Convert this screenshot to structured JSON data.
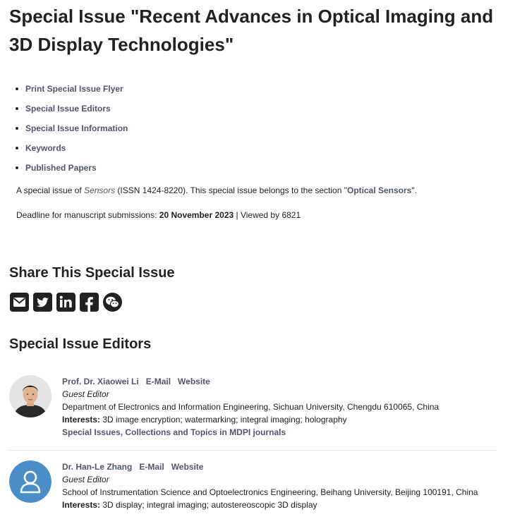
{
  "page": {
    "title": "Special Issue \"Recent Advances in Optical Imaging and 3D Display Technologies\""
  },
  "toc": [
    "Print Special Issue Flyer",
    "Special Issue Editors",
    "Special Issue Information",
    "Keywords",
    "Published Papers"
  ],
  "info": {
    "prefix": "A special issue of ",
    "journal": "Sensors",
    "issn_text": " (ISSN 1424-8220). This special issue belongs to the section \"",
    "section": "Optical Sensors",
    "suffix": "\".",
    "deadline_label": "Deadline for manuscript submissions: ",
    "deadline": "20 November 2023",
    "viewed_text": " | Viewed by 6821"
  },
  "share": {
    "heading": "Share This Special Issue",
    "icons": [
      "email-icon",
      "twitter-icon",
      "linkedin-icon",
      "facebook-icon",
      "wechat-icon"
    ]
  },
  "editors": {
    "heading": "Special Issue Editors",
    "list": [
      {
        "name": "Prof. Dr. Xiaowei Li",
        "email_label": "E-Mail",
        "website_label": "Website",
        "role": "Guest Editor",
        "affiliation": "Department of Electronics and Information Engineering, Sichuan University, Chengdu 610065, China",
        "interests_label": "Interests:",
        "interests": " 3D image encryption; watermarking; integral imaging; holography",
        "extra_link": "Special Issues, Collections and Topics in MDPI journals"
      },
      {
        "name": "Dr. Han-Le Zhang",
        "email_label": "E-Mail",
        "website_label": "Website",
        "role": "Guest Editor",
        "affiliation": "School of Instrumentation Science and Optoelectronics Engineering, Beihang University, Beijing 100191, China",
        "interests_label": "Interests:",
        "interests": " 3D display; integral imaging; autostereoscopic 3D display"
      }
    ]
  },
  "colors": {
    "link": "#4f5671",
    "text": "#222222",
    "avatar_blue": "#4a8ec8"
  }
}
